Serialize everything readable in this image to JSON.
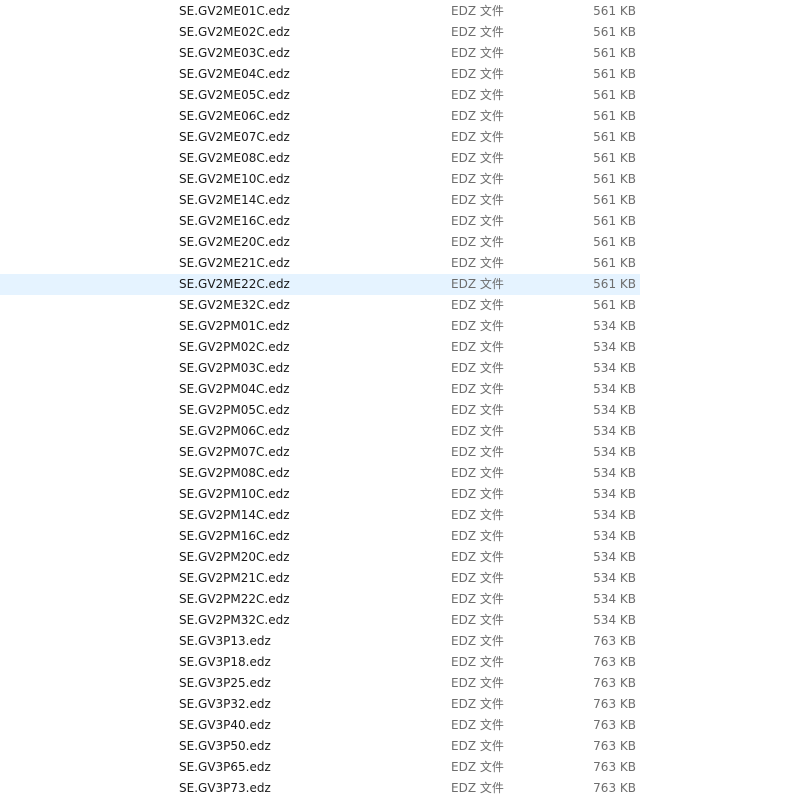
{
  "selected_index": 13,
  "files": [
    {
      "name": "SE.GV2ME01C.edz",
      "type": "EDZ 文件",
      "size": "561 KB"
    },
    {
      "name": "SE.GV2ME02C.edz",
      "type": "EDZ 文件",
      "size": "561 KB"
    },
    {
      "name": "SE.GV2ME03C.edz",
      "type": "EDZ 文件",
      "size": "561 KB"
    },
    {
      "name": "SE.GV2ME04C.edz",
      "type": "EDZ 文件",
      "size": "561 KB"
    },
    {
      "name": "SE.GV2ME05C.edz",
      "type": "EDZ 文件",
      "size": "561 KB"
    },
    {
      "name": "SE.GV2ME06C.edz",
      "type": "EDZ 文件",
      "size": "561 KB"
    },
    {
      "name": "SE.GV2ME07C.edz",
      "type": "EDZ 文件",
      "size": "561 KB"
    },
    {
      "name": "SE.GV2ME08C.edz",
      "type": "EDZ 文件",
      "size": "561 KB"
    },
    {
      "name": "SE.GV2ME10C.edz",
      "type": "EDZ 文件",
      "size": "561 KB"
    },
    {
      "name": "SE.GV2ME14C.edz",
      "type": "EDZ 文件",
      "size": "561 KB"
    },
    {
      "name": "SE.GV2ME16C.edz",
      "type": "EDZ 文件",
      "size": "561 KB"
    },
    {
      "name": "SE.GV2ME20C.edz",
      "type": "EDZ 文件",
      "size": "561 KB"
    },
    {
      "name": "SE.GV2ME21C.edz",
      "type": "EDZ 文件",
      "size": "561 KB"
    },
    {
      "name": "SE.GV2ME22C.edz",
      "type": "EDZ 文件",
      "size": "561 KB"
    },
    {
      "name": "SE.GV2ME32C.edz",
      "type": "EDZ 文件",
      "size": "561 KB"
    },
    {
      "name": "SE.GV2PM01C.edz",
      "type": "EDZ 文件",
      "size": "534 KB"
    },
    {
      "name": "SE.GV2PM02C.edz",
      "type": "EDZ 文件",
      "size": "534 KB"
    },
    {
      "name": "SE.GV2PM03C.edz",
      "type": "EDZ 文件",
      "size": "534 KB"
    },
    {
      "name": "SE.GV2PM04C.edz",
      "type": "EDZ 文件",
      "size": "534 KB"
    },
    {
      "name": "SE.GV2PM05C.edz",
      "type": "EDZ 文件",
      "size": "534 KB"
    },
    {
      "name": "SE.GV2PM06C.edz",
      "type": "EDZ 文件",
      "size": "534 KB"
    },
    {
      "name": "SE.GV2PM07C.edz",
      "type": "EDZ 文件",
      "size": "534 KB"
    },
    {
      "name": "SE.GV2PM08C.edz",
      "type": "EDZ 文件",
      "size": "534 KB"
    },
    {
      "name": "SE.GV2PM10C.edz",
      "type": "EDZ 文件",
      "size": "534 KB"
    },
    {
      "name": "SE.GV2PM14C.edz",
      "type": "EDZ 文件",
      "size": "534 KB"
    },
    {
      "name": "SE.GV2PM16C.edz",
      "type": "EDZ 文件",
      "size": "534 KB"
    },
    {
      "name": "SE.GV2PM20C.edz",
      "type": "EDZ 文件",
      "size": "534 KB"
    },
    {
      "name": "SE.GV2PM21C.edz",
      "type": "EDZ 文件",
      "size": "534 KB"
    },
    {
      "name": "SE.GV2PM22C.edz",
      "type": "EDZ 文件",
      "size": "534 KB"
    },
    {
      "name": "SE.GV2PM32C.edz",
      "type": "EDZ 文件",
      "size": "534 KB"
    },
    {
      "name": "SE.GV3P13.edz",
      "type": "EDZ 文件",
      "size": "763 KB"
    },
    {
      "name": "SE.GV3P18.edz",
      "type": "EDZ 文件",
      "size": "763 KB"
    },
    {
      "name": "SE.GV3P25.edz",
      "type": "EDZ 文件",
      "size": "763 KB"
    },
    {
      "name": "SE.GV3P32.edz",
      "type": "EDZ 文件",
      "size": "763 KB"
    },
    {
      "name": "SE.GV3P40.edz",
      "type": "EDZ 文件",
      "size": "763 KB"
    },
    {
      "name": "SE.GV3P50.edz",
      "type": "EDZ 文件",
      "size": "763 KB"
    },
    {
      "name": "SE.GV3P65.edz",
      "type": "EDZ 文件",
      "size": "763 KB"
    },
    {
      "name": "SE.GV3P73.edz",
      "type": "EDZ 文件",
      "size": "763 KB"
    }
  ]
}
